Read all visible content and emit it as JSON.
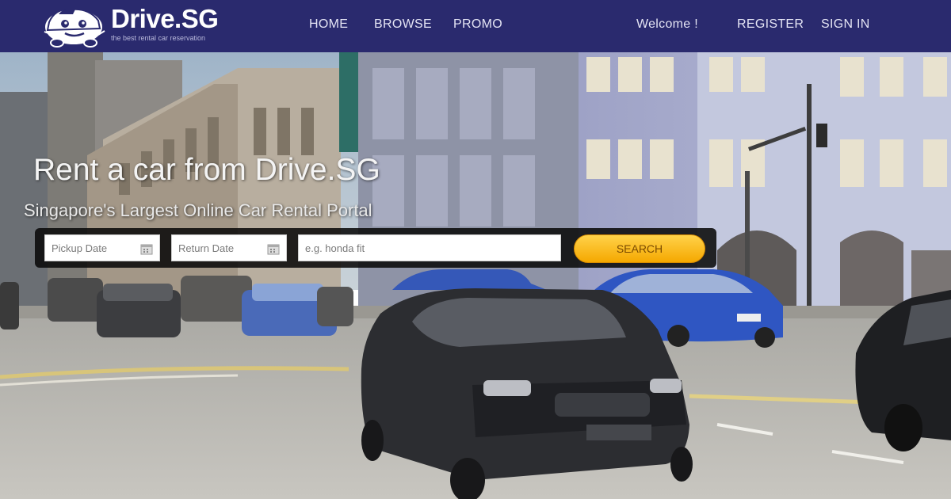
{
  "brand": {
    "name": "Drive.SG",
    "tagline": "the best rental car reservation"
  },
  "nav": {
    "items": [
      {
        "label": "HOME"
      },
      {
        "label": "BROWSE"
      },
      {
        "label": "PROMO"
      }
    ],
    "welcome": "Welcome !",
    "register": "REGISTER",
    "signin": "SIGN IN"
  },
  "hero": {
    "title": "Rent a car from Drive.SG",
    "subtitle": "Singapore's Largest Online Car Rental Portal"
  },
  "search": {
    "pickup_placeholder": "Pickup Date",
    "return_placeholder": "Return Date",
    "query_placeholder": "e.g. honda fit",
    "button_label": "SEARCH"
  },
  "colors": {
    "header_bg": "#2a2a6e",
    "search_button": "#f5a800"
  },
  "icons": {
    "logo": "car-mascot-icon",
    "date": "calendar-icon"
  }
}
